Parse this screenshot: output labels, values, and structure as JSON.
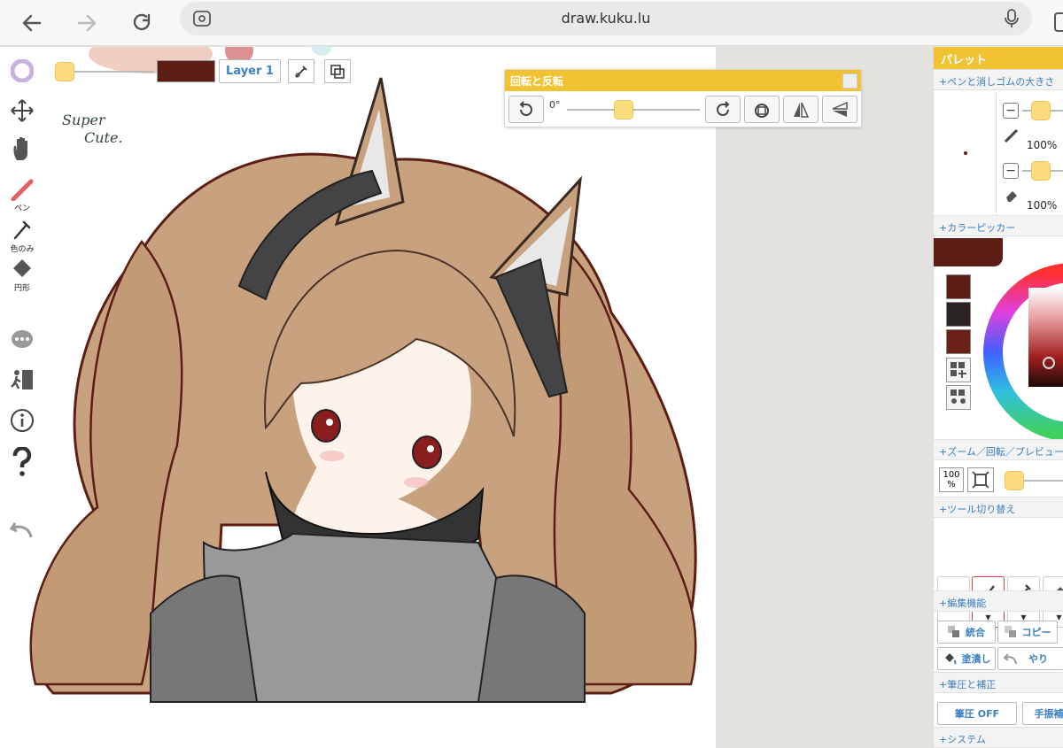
{
  "browser": {
    "url": "draw.kuku.lu",
    "back_icon": "arrow-left-icon",
    "forward_icon": "arrow-right-icon",
    "reload_icon": "reload-icon",
    "mic_icon": "microphone-icon"
  },
  "canvas": {
    "handwriting_line1": "Super",
    "handwriting_line2": "Cute."
  },
  "topbar": {
    "layer_label": "Layer 1",
    "current_color": "#5c1e14"
  },
  "left_tools": {
    "pen_label": "ペン",
    "eyedropper_label": "色のみ",
    "shape_label": "円形"
  },
  "rotation_panel": {
    "title": "回転と反転",
    "angle": "0°"
  },
  "palette": {
    "title": "パレット",
    "pen_eraser_size_header": "+ペンと消しゴムの大きさ",
    "pen_opacity": "100%",
    "eraser_opacity": "100%",
    "color_picker_header": "+カラーピッカー",
    "zoom_header": "+ズーム／回転／プレビュー",
    "zoom_badge_top": "100",
    "zoom_badge_bottom": "%",
    "tool_switch_header": "+ツール切り替え",
    "tool_pen": "ペン",
    "tool_eyedropper": "色のみ",
    "tool_shape": "円形",
    "edit_header": "+編集機能",
    "merge_button": "統合",
    "copy_button": "コピー",
    "fill_button": "塗潰し",
    "undo_button": "やり",
    "pressure_header": "+筆圧と補正",
    "pressure_button": "筆圧 OFF",
    "stabilizer_button": "手振補",
    "system_header": "+システム",
    "swatches": [
      "#5c1e14",
      "#2a2520",
      "#6b2216"
    ]
  }
}
